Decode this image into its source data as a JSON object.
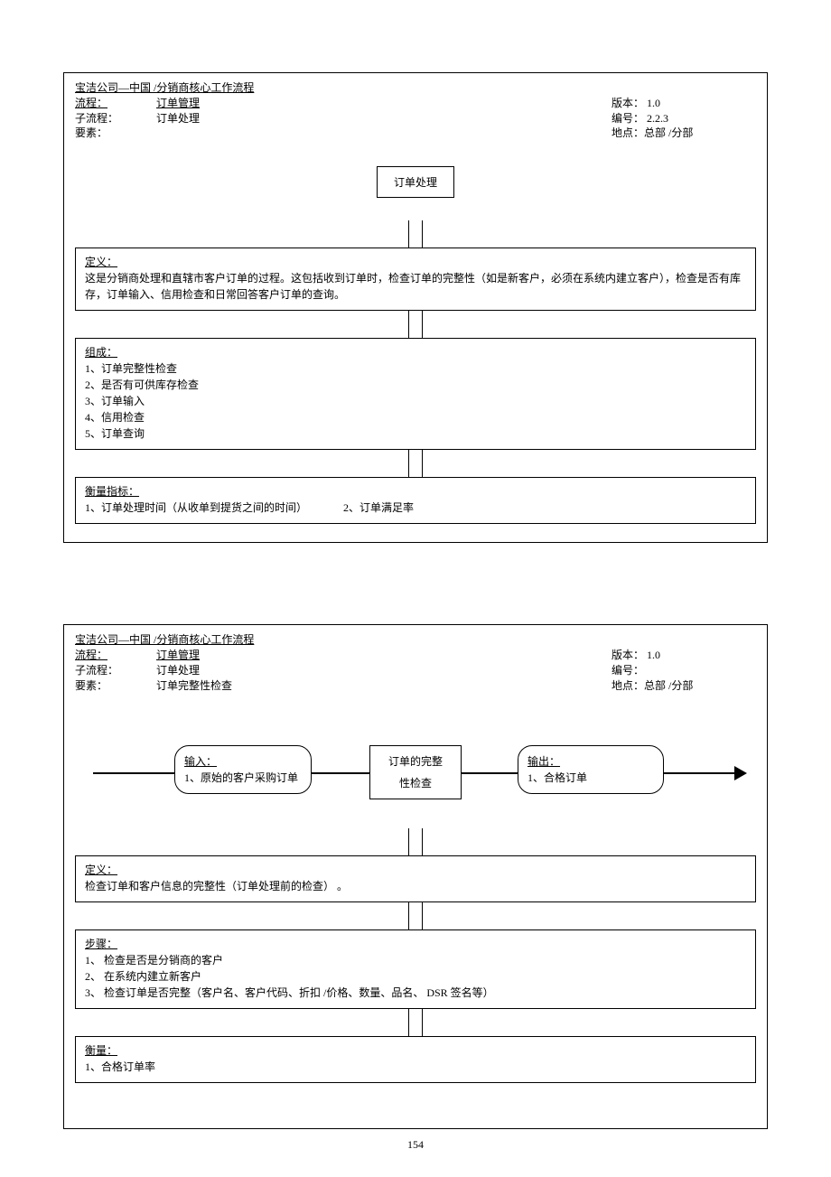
{
  "page_number": "154",
  "doc1": {
    "company_line": "宝洁公司—中国 /分销商核心工作流程",
    "labels": {
      "process": "流程：",
      "subprocess": "子流程：",
      "element": "要素：",
      "version": "版本：",
      "number": "编号：",
      "location": "地点："
    },
    "process": "订单管理",
    "subprocess": "订单处理",
    "element": "",
    "version": "1.0",
    "number": "2.2.3",
    "location": "总部 /分部",
    "center_box": "订单处理",
    "def_title": "定义：",
    "def_body": "这是分销商处理和直辖市客户订单的过程。这包括收到订单时，检查订单的完整性（如是新客户，必须在系统内建立客户），检查是否有库存，订单输入、信用检查和日常回答客户订单的查询。",
    "comp_title": "组成：",
    "comp_items": [
      "1、订单完整性检查",
      "2、是否有可供库存检查",
      "3、订单输入",
      "4、信用检查",
      "5、订单查询"
    ],
    "metric_title": "衡量指标：",
    "metric_1": "1、订单处理时间（从收单到提货之间的时间）",
    "metric_2": "2、订单满足率"
  },
  "doc2": {
    "company_line": "宝洁公司—中国 /分销商核心工作流程",
    "labels": {
      "process": "流程：",
      "subprocess": "子流程：",
      "element": "要素：",
      "version": "版本：",
      "number": "编号：",
      "location": "地点："
    },
    "process": "订单管理",
    "subprocess": "订单处理",
    "element": "订单完整性检查",
    "version": "1.0",
    "number": "",
    "location": "总部 /分部",
    "input_title": "输入：",
    "input_body": "1、原始的客户采购订单",
    "process_box_l1": "订单的完整",
    "process_box_l2": "性检查",
    "output_title": "输出：",
    "output_body": "1、合格订单",
    "def_title": "定义：",
    "def_body": "检查订单和客户信息的完整性（订单处理前的检查）   。",
    "steps_title": "步骤：",
    "steps": [
      "1、   检查是否是分销商的客户",
      "2、   在系统内建立新客户",
      "3、   检查订单是否完整（客户名、客户代码、折扣   /价格、数量、品名、 DSR 签名等）"
    ],
    "measure_title": "衡量：",
    "measure_body": "1、合格订单率"
  }
}
